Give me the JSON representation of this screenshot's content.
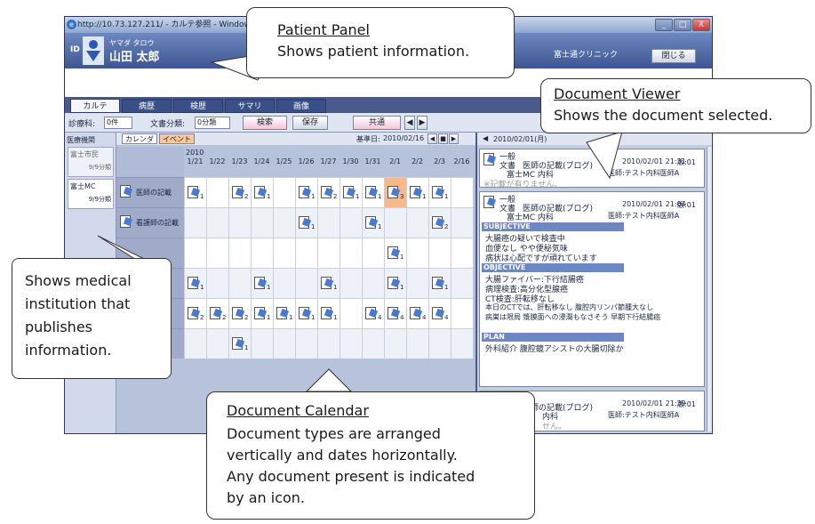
{
  "window": {
    "title": "http://10.73.127.211/ - カルテ参照 - Windows Internet E",
    "minimize": "_",
    "maximize": "□",
    "close": "X"
  },
  "patient": {
    "id_label": "ID",
    "kana": "ヤマダ タロウ",
    "name": "山田 太郎",
    "clinic": "富士通クリニック",
    "close_button": "閉じる"
  },
  "tabs": [
    "カルテ",
    "病歴",
    "検歴",
    "サマリ",
    "画像"
  ],
  "toolbar": {
    "dept_label": "診療科:",
    "dept_value": "0件",
    "doctype_label": "文書分類:",
    "doctype_value": "0分類",
    "search": "検索",
    "save": "保存",
    "shared": "共通"
  },
  "sidebar": {
    "header": "医療機関",
    "items": [
      {
        "name": "富士市民",
        "sub": "9/9分類"
      },
      {
        "name": "富士MC",
        "sub": "9/9分類"
      }
    ]
  },
  "calendar": {
    "tabs": [
      "カレンダ",
      "イベント"
    ],
    "base_date_label": "基準日:",
    "base_date": "2010/02/16",
    "year_label": "2010",
    "dates": [
      "1/21",
      "1/22",
      "1/23",
      "1/24",
      "1/25",
      "1/26",
      "1/27",
      "1/30",
      "1/31",
      "2/1",
      "2/2",
      "2/3",
      "2/16"
    ],
    "rows": [
      {
        "label": "医師の記載",
        "cells": [
          "1",
          "",
          "2",
          "1",
          "",
          "1",
          "2",
          "1",
          "1",
          "3",
          "1",
          "1",
          ""
        ],
        "selected": 9
      },
      {
        "label": "看護師の記載",
        "cells": [
          "",
          "",
          "",
          "",
          "",
          "1",
          "",
          "",
          "1",
          "",
          "",
          "2",
          ""
        ]
      },
      {
        "label": "",
        "cells": [
          "",
          "",
          "",
          "",
          "",
          "",
          "",
          "",
          "",
          "1",
          "",
          "",
          ""
        ]
      },
      {
        "label": "",
        "cells": [
          "1",
          "",
          "",
          "1",
          "",
          "",
          "1",
          "",
          "",
          "1",
          "",
          "1",
          ""
        ]
      },
      {
        "label": "",
        "cells": [
          "2",
          "2",
          "2",
          "1",
          "1",
          "1",
          "1",
          "",
          "4",
          "4",
          "4",
          "4",
          ""
        ]
      },
      {
        "label": "",
        "cells": [
          "",
          "",
          "1",
          "",
          "",
          "",
          "",
          "",
          "",
          "",
          "",
          "",
          ""
        ]
      }
    ]
  },
  "viewer": {
    "date": "2010/02/01(月)",
    "cards": [
      {
        "category": "一般",
        "type": "文書",
        "title": "医師の記載(ブログ)",
        "datetime": "2010/02/01 21:31",
        "version": "版:01",
        "dept": "富士MC 内科",
        "doctor": "医師:テスト内科医師A",
        "note": "※記載が有りません。"
      },
      {
        "category": "一般",
        "type": "文書",
        "title": "医師の記載(ブログ)",
        "datetime": "2010/02/01 21:04",
        "version": "版:01",
        "dept": "富士MC 内科",
        "doctor": "医師:テスト内科医師A"
      },
      {
        "category": "一般",
        "type": "文書",
        "title": "医師の記載(ブログ)",
        "datetime": "2010/02/01 21:39",
        "version": "版:01",
        "dept": "内科",
        "doctor": "医師:テスト内科医師A",
        "note": "せん。"
      }
    ],
    "sections": {
      "subjective": {
        "heading": "SUBJECTIVE",
        "lines": [
          "大腸癌の疑いで検査中",
          "血便なし やや便秘気味",
          "病状は心配ですが頑れています"
        ]
      },
      "objective": {
        "heading": "OBJECTIVE",
        "lines": [
          "大腸ファイバー:下行結腸癌",
          "病理検査:高分化型腺癌",
          "CT検査:肝転移なし",
          "本日のCTでは、肝転移なし 腹腔内リンパ節腫大なし",
          "病巣は限局 漿膜面への浸潤もなさそう 早期下行結腸癌"
        ]
      },
      "plan": {
        "heading": "PLAN",
        "lines": [
          "外科紹介 腹腔鏡アシストの大腸切除か"
        ]
      }
    }
  },
  "callouts": {
    "patient_panel": {
      "title": "Patient Panel",
      "text": "Shows patient information."
    },
    "document_viewer": {
      "title": "Document Viewer",
      "text": "Shows the document selected."
    },
    "institution": {
      "lines": [
        "Shows medical",
        "institution that",
        "publishes",
        "information."
      ]
    },
    "document_calendar": {
      "title": "Document Calendar",
      "lines": [
        "Document types are arranged",
        "vertically and dates horizontally.",
        "Any document present is indicated",
        "by an icon."
      ]
    }
  }
}
